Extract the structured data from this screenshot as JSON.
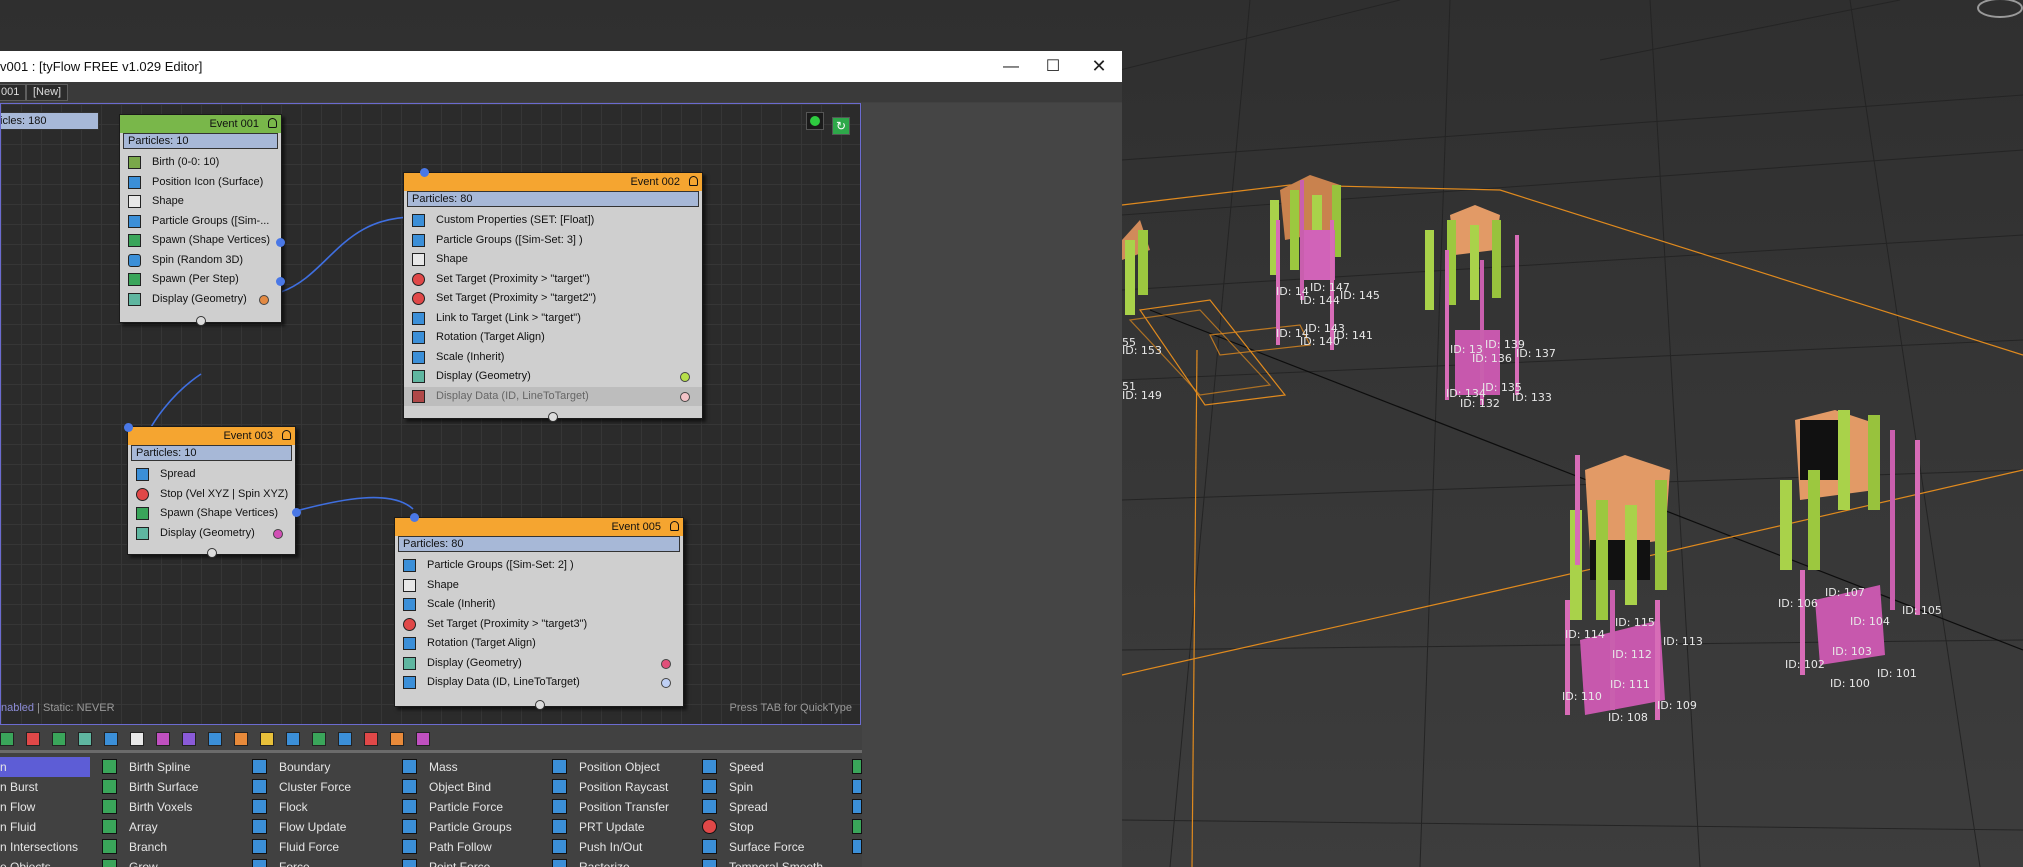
{
  "window": {
    "title": "v001 : [tyFlow FREE v1.029 Editor]",
    "minimize_icon": "minimize-icon",
    "maximize_icon": "maximize-icon",
    "close_icon": "close-icon"
  },
  "tabs": [
    {
      "label": "001"
    },
    {
      "label": "[New]"
    }
  ],
  "canvas": {
    "partial_node_label": "icles: 180",
    "status_enabled": "nabled",
    "status_static": " | Static: NEVER",
    "hint": "Press TAB for QuickType"
  },
  "events": [
    {
      "title": "Event 001",
      "header_color": "#79b74a",
      "particles": "Particles: 10",
      "operators": [
        {
          "label": "Birth (0-0: 10)"
        },
        {
          "label": "Position Icon (Surface)"
        },
        {
          "label": "Shape"
        },
        {
          "label": "Particle Groups ([Sim-..."
        },
        {
          "label": "Spawn (Shape Vertices)"
        },
        {
          "label": "Spin (Random 3D)"
        },
        {
          "label": "Spawn (Per Step)"
        },
        {
          "label": "Display (Geometry)",
          "dot": "#e38a43"
        }
      ]
    },
    {
      "title": "Event 002",
      "header_color": "#f5a530",
      "particles": "Particles: 80",
      "operators": [
        {
          "label": "Custom Properties (SET: [Float])"
        },
        {
          "label": "Particle Groups ([Sim-Set: 3] )"
        },
        {
          "label": "Shape"
        },
        {
          "label": "Set Target (Proximity > \"target\")"
        },
        {
          "label": "Set Target (Proximity > \"target2\")"
        },
        {
          "label": "Link to Target (Link > \"target\")"
        },
        {
          "label": "Rotation (Target Align)"
        },
        {
          "label": "Scale (Inherit)"
        },
        {
          "label": "Display (Geometry)",
          "dot": "#b7e04a"
        },
        {
          "label": "Display Data (ID, LineToTarget)",
          "dot": "#f3c3c8"
        }
      ]
    },
    {
      "title": "Event 003",
      "header_color": "#f5a530",
      "particles": "Particles: 10",
      "operators": [
        {
          "label": "Spread"
        },
        {
          "label": "Stop (Vel XYZ | Spin XYZ)"
        },
        {
          "label": "Spawn (Shape Vertices)"
        },
        {
          "label": "Display (Geometry)",
          "dot": "#d14fb5"
        }
      ]
    },
    {
      "title": "Event 005",
      "header_color": "#f5a530",
      "particles": "Particles: 80",
      "operators": [
        {
          "label": "Particle Groups ([Sim-Set: 2] )"
        },
        {
          "label": "Shape"
        },
        {
          "label": "Scale (Inherit)"
        },
        {
          "label": "Set Target (Proximity > \"target3\")"
        },
        {
          "label": "Rotation (Target Align)"
        },
        {
          "label": "Display (Geometry)",
          "dot": "#e0507a"
        },
        {
          "label": "Display Data (ID, LineToTarget)",
          "dot": "#bfd0f5"
        }
      ]
    }
  ],
  "palette": {
    "col0": [
      "n",
      "n Burst",
      "n Flow",
      "n Fluid",
      "n Intersections",
      "e Objects"
    ],
    "col1": [
      "Birth Spline",
      "Birth Surface",
      "Birth Voxels",
      "Array",
      "Branch",
      "Grow"
    ],
    "col2": [
      "Boundary",
      "Cluster Force",
      "Flock",
      "Flow Update",
      "Fluid Force",
      "Force"
    ],
    "col3": [
      "Mass",
      "Object Bind",
      "Particle Force",
      "Particle Groups",
      "Path Follow",
      "Point Force"
    ],
    "col4": [
      "Position Object",
      "Position Raycast",
      "Position Transfer",
      "PRT Update",
      "Push In/Out",
      "Rasterize"
    ],
    "col5": [
      "Speed",
      "Spin",
      "Spread",
      "Stop",
      "Surface Force",
      "Temporal Smooth"
    ]
  },
  "viewport_labels": [
    {
      "text": "ID: 147"
    },
    {
      "text": "ID: 14"
    },
    {
      "text": "ID: 144"
    },
    {
      "text": "ID: 145"
    },
    {
      "text": "ID: 14"
    },
    {
      "text": "ID: 143"
    },
    {
      "text": "ID: 140"
    },
    {
      "text": "ID: 141"
    },
    {
      "text": "55"
    },
    {
      "text": "ID: 153"
    },
    {
      "text": "51"
    },
    {
      "text": "ID: 149"
    },
    {
      "text": "ID: 139"
    },
    {
      "text": "ID: 13"
    },
    {
      "text": "ID: 136"
    },
    {
      "text": "ID: 137"
    },
    {
      "text": "ID: 134"
    },
    {
      "text": "ID: 135"
    },
    {
      "text": "ID: 133"
    },
    {
      "text": "ID: 132"
    },
    {
      "text": "ID: 115"
    },
    {
      "text": "ID: 114"
    },
    {
      "text": "ID: 113"
    },
    {
      "text": "ID: 112"
    },
    {
      "text": "ID: 111"
    },
    {
      "text": "ID: 110"
    },
    {
      "text": "ID: 109"
    },
    {
      "text": "ID: 108"
    },
    {
      "text": "ID: 107"
    },
    {
      "text": "ID: 106"
    },
    {
      "text": "ID: 105"
    },
    {
      "text": "ID: 104"
    },
    {
      "text": "ID: 103"
    },
    {
      "text": "ID: 102"
    },
    {
      "text": "ID: 101"
    },
    {
      "text": "ID: 100"
    }
  ]
}
